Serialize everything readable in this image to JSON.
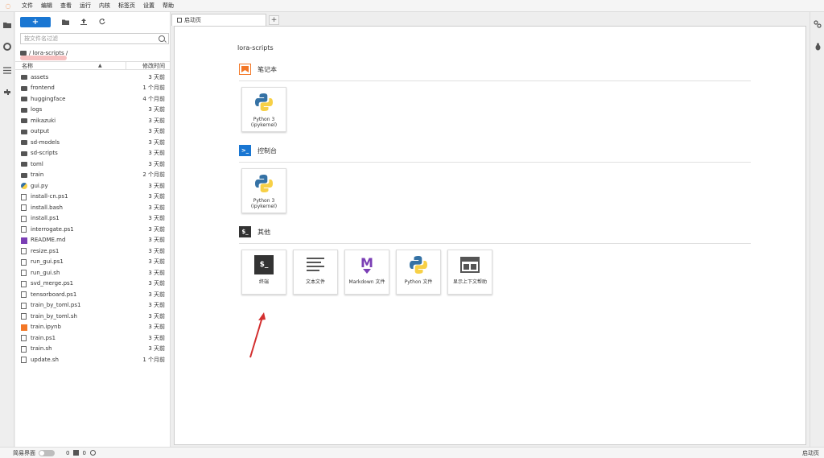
{
  "menubar": {
    "items": [
      "文件",
      "编辑",
      "查看",
      "运行",
      "内核",
      "标签页",
      "设置",
      "帮助"
    ]
  },
  "file_browser": {
    "new_button_label": "+",
    "filter_placeholder": "按文件名过滤",
    "breadcrumb": "/ lora-scripts /",
    "columns": {
      "name": "名称",
      "modified": "修改时间",
      "sort_indicator": "▲"
    },
    "files": [
      {
        "name": "assets",
        "type": "folder",
        "modified": "3 天前"
      },
      {
        "name": "frontend",
        "type": "folder",
        "modified": "1 个月前"
      },
      {
        "name": "huggingface",
        "type": "folder",
        "modified": "4 个月前"
      },
      {
        "name": "logs",
        "type": "folder",
        "modified": "3 天前"
      },
      {
        "name": "mikazuki",
        "type": "folder",
        "modified": "3 天前"
      },
      {
        "name": "output",
        "type": "folder",
        "modified": "3 天前"
      },
      {
        "name": "sd-models",
        "type": "folder",
        "modified": "3 天前"
      },
      {
        "name": "sd-scripts",
        "type": "folder",
        "modified": "3 天前"
      },
      {
        "name": "toml",
        "type": "folder",
        "modified": "3 天前"
      },
      {
        "name": "train",
        "type": "folder",
        "modified": "2 个月前"
      },
      {
        "name": "gui.py",
        "type": "py",
        "modified": "3 天前"
      },
      {
        "name": "install-cn.ps1",
        "type": "doc",
        "modified": "3 天前"
      },
      {
        "name": "install.bash",
        "type": "doc",
        "modified": "3 天前"
      },
      {
        "name": "install.ps1",
        "type": "doc",
        "modified": "3 天前"
      },
      {
        "name": "interrogate.ps1",
        "type": "doc",
        "modified": "3 天前"
      },
      {
        "name": "README.md",
        "type": "md",
        "modified": "3 天前"
      },
      {
        "name": "resize.ps1",
        "type": "doc",
        "modified": "3 天前"
      },
      {
        "name": "run_gui.ps1",
        "type": "doc",
        "modified": "3 天前"
      },
      {
        "name": "run_gui.sh",
        "type": "doc",
        "modified": "3 天前"
      },
      {
        "name": "svd_merge.ps1",
        "type": "doc",
        "modified": "3 天前"
      },
      {
        "name": "tensorboard.ps1",
        "type": "doc",
        "modified": "3 天前"
      },
      {
        "name": "train_by_toml.ps1",
        "type": "doc",
        "modified": "3 天前"
      },
      {
        "name": "train_by_toml.sh",
        "type": "doc",
        "modified": "3 天前"
      },
      {
        "name": "train.ipynb",
        "type": "nb",
        "modified": "3 天前"
      },
      {
        "name": "train.ps1",
        "type": "doc",
        "modified": "3 天前"
      },
      {
        "name": "train.sh",
        "type": "doc",
        "modified": "3 天前"
      },
      {
        "name": "update.sh",
        "type": "doc",
        "modified": "1 个月前"
      }
    ]
  },
  "tabs": {
    "launcher_label": "启动页",
    "add_label": "+"
  },
  "launcher": {
    "path": "lora-scripts",
    "sections": {
      "notebook": {
        "title": "笔记本",
        "cards": [
          {
            "label_line1": "Python 3",
            "label_line2": "(ipykernel)"
          }
        ]
      },
      "console": {
        "title": "控制台",
        "icon_text": ">_",
        "cards": [
          {
            "label_line1": "Python 3",
            "label_line2": "(ipykernel)"
          }
        ]
      },
      "other": {
        "title": "其他",
        "icon_text": "$_",
        "cards": [
          {
            "label": "终端",
            "visual": "$_"
          },
          {
            "label": "文本文件"
          },
          {
            "label": "Markdown 文件",
            "visual": "M"
          },
          {
            "label": "Python 文件"
          },
          {
            "label": "显示上下文帮助"
          }
        ]
      }
    }
  },
  "statusbar": {
    "simple_mode_label": "简易界面",
    "kernels_count": "0",
    "terminals_count": "0",
    "right_label": "启动页"
  },
  "colors": {
    "accent": "#1976d2",
    "jupyter_orange": "#f37726",
    "python_blue": "#3572a5",
    "python_yellow": "#f7d046",
    "markdown_purple": "#7b3fb5",
    "arrow_red": "#d32f2f"
  }
}
